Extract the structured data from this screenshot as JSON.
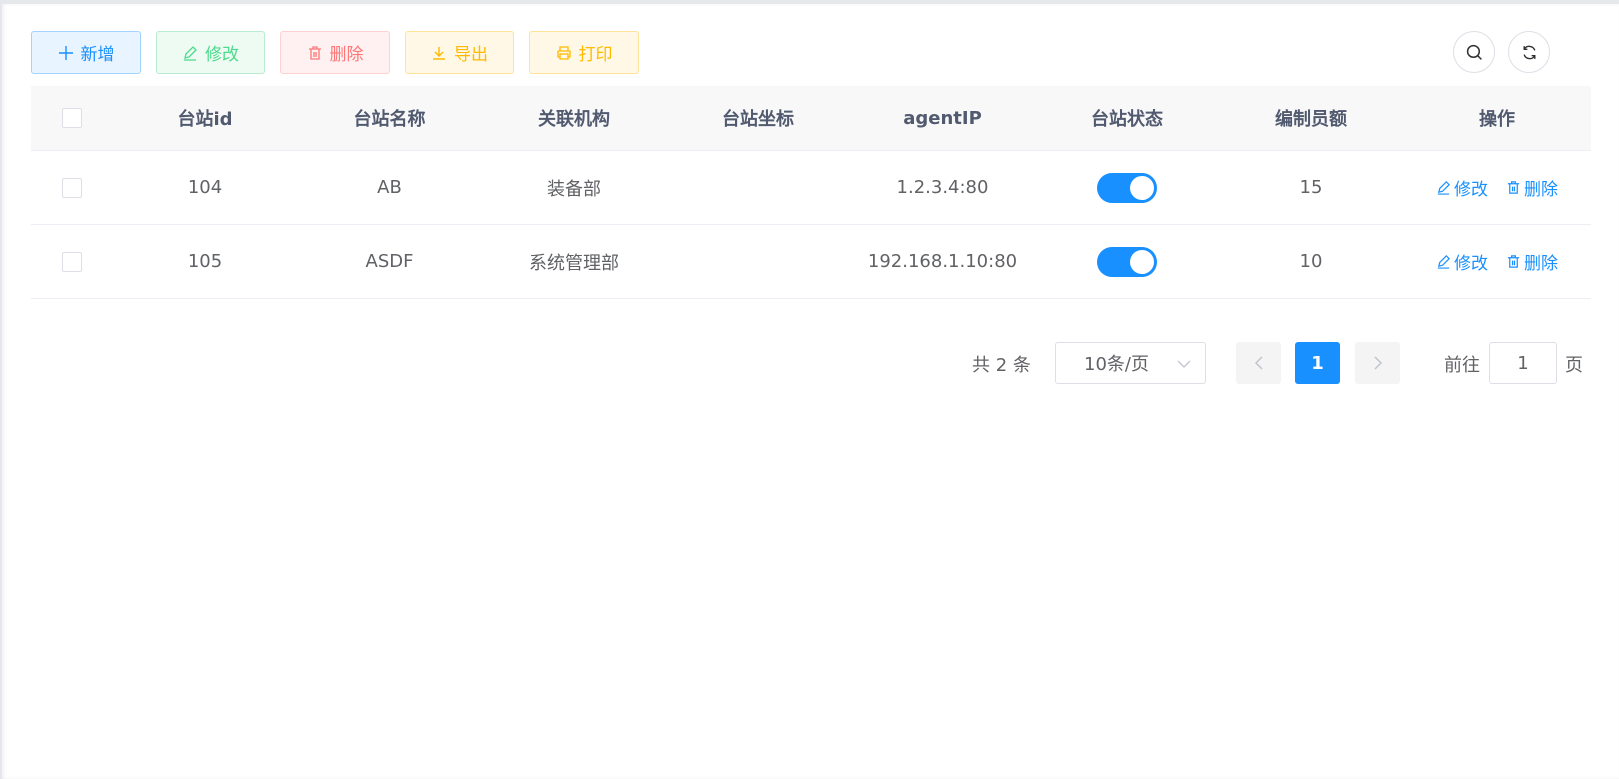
{
  "toolbar": {
    "add_label": "新增",
    "edit_label": "修改",
    "delete_label": "删除",
    "export_label": "导出",
    "print_label": "打印"
  },
  "colors": {
    "primary": "#1890ff",
    "success": "#13ce66",
    "danger": "#ff4949",
    "warning": "#ffba00"
  },
  "table": {
    "columns": [
      "台站id",
      "台站名称",
      "关联机构",
      "台站坐标",
      "agentIP",
      "台站状态",
      "编制员额",
      "操作"
    ],
    "rows": [
      {
        "id": "104",
        "name": "AB",
        "org": "装备部",
        "coord": "",
        "agent_ip": "1.2.3.4:80",
        "status_on": true,
        "staff": "15",
        "edit": "修改",
        "delete": "删除"
      },
      {
        "id": "105",
        "name": "ASDF",
        "org": "系统管理部",
        "coord": "",
        "agent_ip": "192.168.1.10:80",
        "status_on": true,
        "staff": "10",
        "edit": "修改",
        "delete": "删除"
      }
    ]
  },
  "pagination": {
    "total_text": "共 2 条",
    "page_size": "10条/页",
    "current_page": "1",
    "goto_label": "前往",
    "goto_value": "1",
    "goto_suffix": "页"
  },
  "icons": [
    "plus-icon",
    "edit-icon",
    "trash-icon",
    "download-icon",
    "printer-icon",
    "search-icon",
    "refresh-icon",
    "chevron-down-icon",
    "chevron-left-icon",
    "chevron-right-icon"
  ]
}
